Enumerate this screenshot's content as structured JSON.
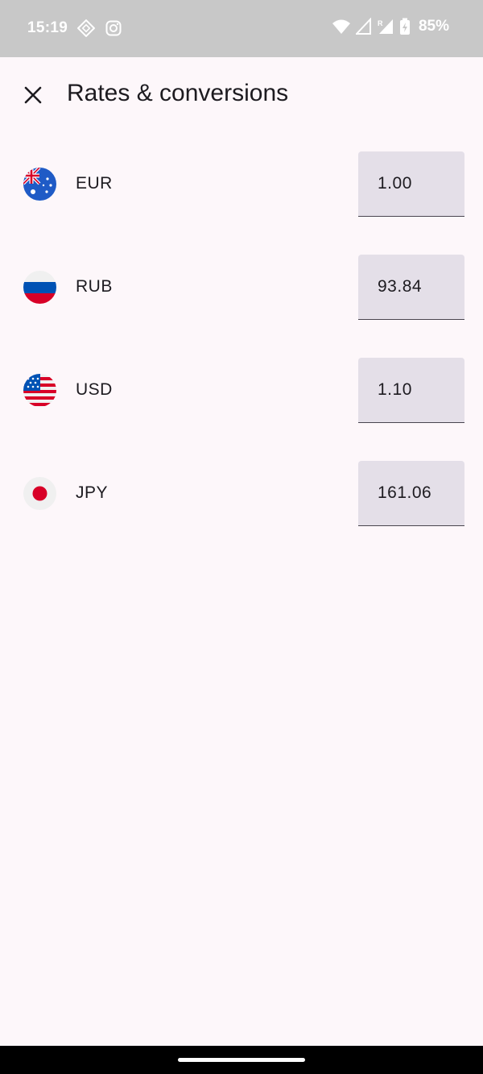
{
  "status_bar": {
    "time": "15:19",
    "battery": "85%",
    "icons": [
      "app-notification-icon",
      "instagram-icon",
      "wifi-icon",
      "cell-signal-icon",
      "cell-signal-roaming-icon",
      "battery-icon"
    ]
  },
  "header": {
    "close_icon": "close-icon",
    "title": "Rates & conversions"
  },
  "rates": [
    {
      "code": "EUR",
      "value": "1.00",
      "flag": "eur-flag-icon"
    },
    {
      "code": "RUB",
      "value": "93.84",
      "flag": "rub-flag-icon"
    },
    {
      "code": "USD",
      "value": "1.10",
      "flag": "usd-flag-icon"
    },
    {
      "code": "JPY",
      "value": "161.06",
      "flag": "jpy-flag-icon"
    }
  ],
  "colors": {
    "background": "#fdf7fa",
    "field_background": "#e4dfe8",
    "status_bar": "#c8c8c8",
    "text": "#1d1b20"
  }
}
